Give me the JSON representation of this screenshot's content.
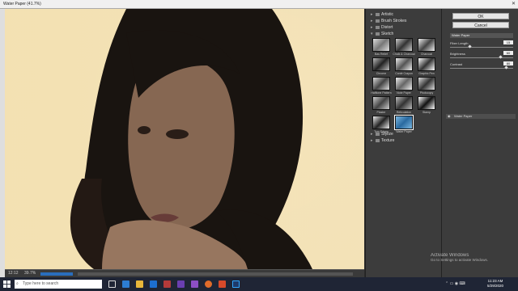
{
  "window": {
    "title": "Water Paper (41.7%)",
    "close_icon": "close-icon"
  },
  "preview": {
    "zoom_label": "12:12",
    "zoom_value": "39.7%"
  },
  "filter_folders": [
    {
      "label": "Artistic"
    },
    {
      "label": "Brush Strokes"
    },
    {
      "label": "Distort"
    },
    {
      "label": "Sketch"
    }
  ],
  "sketch_filters": [
    {
      "label": "Bas Relief"
    },
    {
      "label": "Chalk & Charcoal"
    },
    {
      "label": "Charcoal"
    },
    {
      "label": "Chrome"
    },
    {
      "label": "Conté Crayon"
    },
    {
      "label": "Graphic Pen"
    },
    {
      "label": "Halftone Pattern"
    },
    {
      "label": "Note Paper"
    },
    {
      "label": "Photocopy"
    },
    {
      "label": "Plaster"
    },
    {
      "label": "Reticulation"
    },
    {
      "label": "Stamp"
    },
    {
      "label": "Torn Edges"
    },
    {
      "label": "Water Paper"
    }
  ],
  "more_folders": [
    {
      "label": "Stylize"
    },
    {
      "label": "Texture"
    }
  ],
  "buttons": {
    "ok": "OK",
    "cancel": "Cancel"
  },
  "filter_select": {
    "value": "Water Paper"
  },
  "params": [
    {
      "label": "Fiber Length",
      "value": "15",
      "fraction": 0.3
    },
    {
      "label": "Brightness",
      "value": "60",
      "fraction": 0.8
    },
    {
      "label": "Contrast",
      "value": "80",
      "fraction": 0.9
    }
  ],
  "layer": {
    "label": "Water Paper"
  },
  "watermark": {
    "title": "Activate Windows",
    "subtitle": "Go to Settings to activate Windows."
  },
  "taskbar": {
    "search_placeholder": "Type here to search",
    "time": "11:23 AM",
    "date": "5/29/2020"
  }
}
